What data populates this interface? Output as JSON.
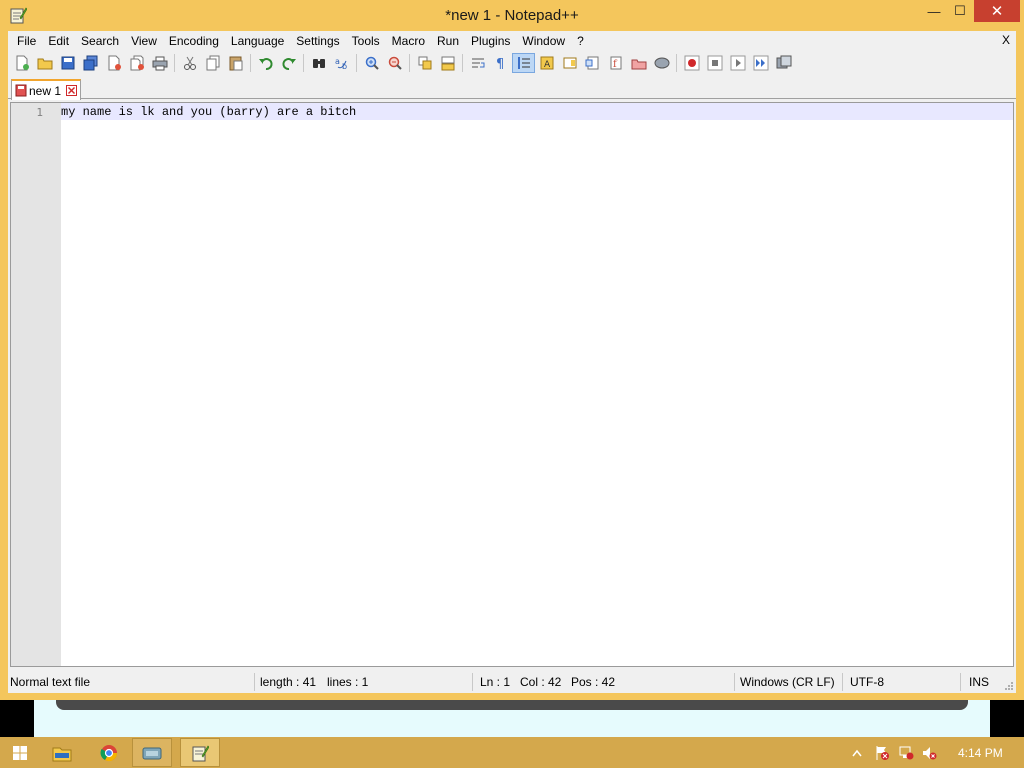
{
  "window": {
    "title": "*new 1 - Notepad++",
    "close_glyph": "✕",
    "min_glyph": "—",
    "max_glyph": "☐"
  },
  "menu": {
    "items": [
      "File",
      "Edit",
      "Search",
      "View",
      "Encoding",
      "Language",
      "Settings",
      "Tools",
      "Macro",
      "Run",
      "Plugins",
      "Window",
      "?"
    ],
    "close_label": "X"
  },
  "toolbar": {
    "icons": [
      "new-file-icon",
      "open-file-icon",
      "save-icon",
      "save-all-icon",
      "close-icon",
      "close-all-icon",
      "print-icon",
      "cut-icon",
      "copy-icon",
      "paste-icon",
      "undo-icon",
      "redo-icon",
      "find-icon",
      "replace-icon",
      "zoom-in-icon",
      "zoom-out-icon",
      "sync-vertical-icon",
      "sync-horizontal-icon",
      "word-wrap-icon",
      "show-all-chars-icon",
      "indent-guide-icon",
      "udl-icon",
      "doc-map-icon",
      "function-list-icon",
      "folder-workspace-icon",
      "doc-switcher-icon",
      "monitoring-icon",
      "record-macro-icon",
      "stop-macro-icon",
      "play-macro-icon",
      "run-macro-multiple-icon",
      "save-macro-icon"
    ]
  },
  "tabs": [
    {
      "label": "new 1",
      "modified": true
    }
  ],
  "editor": {
    "line_number": "1",
    "line_text": "my name is lk and you (barry) are a bitch"
  },
  "status": {
    "file_type": "Normal text file",
    "length": "length : 41",
    "lines": "lines : 1",
    "ln": "Ln : 1",
    "col": "Col : 42",
    "pos": "Pos : 42",
    "eol": "Windows (CR LF)",
    "encoding": "UTF-8",
    "mode": "INS"
  },
  "taskbar": {
    "clock": "4:14 PM"
  },
  "colors": {
    "frame": "#f4c65c",
    "taskbar": "#d4a84c",
    "current_line": "#e8e8ff",
    "gutter": "#e4e4e4"
  }
}
